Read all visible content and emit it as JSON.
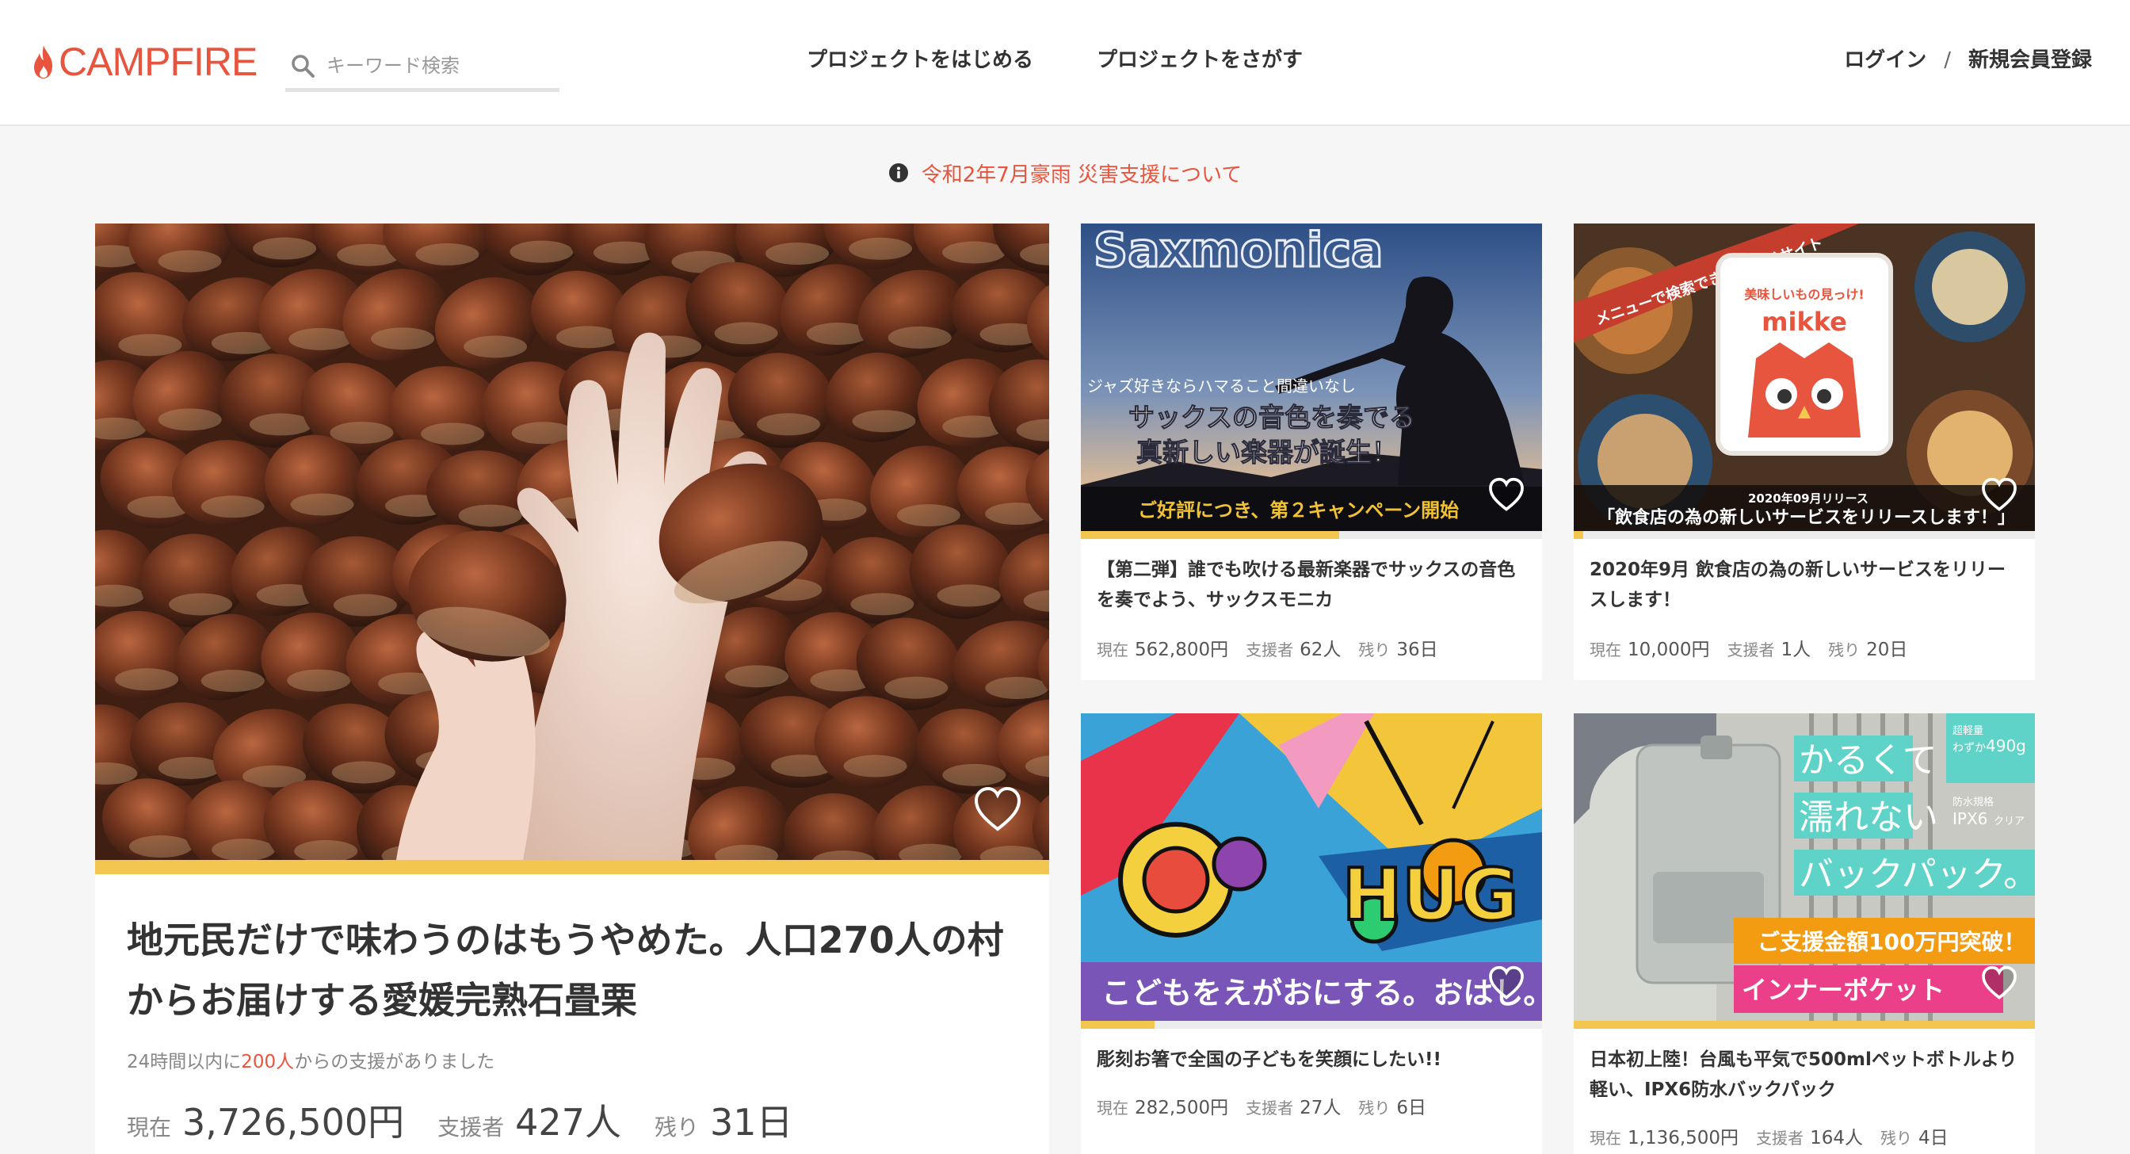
{
  "header": {
    "logo_text": "CAMPFIRE",
    "search_placeholder": "キーワード検索",
    "nav_start": "プロジェクトをはじめる",
    "nav_find": "プロジェクトをさがす",
    "login": "ログイン",
    "separator": "/",
    "register": "新規会員登録"
  },
  "notice": {
    "icon": "info-icon",
    "text": "令和2年7月豪雨 災害支援について"
  },
  "colors": {
    "brand": "#e8553e",
    "progress": "#f3c64f"
  },
  "featured": {
    "title": "地元民だけで味わうのはもうやめた。人口270人の村からお届けする愛媛完熟石畳栗",
    "support_prefix": "24時間以内に",
    "support_count": "200人",
    "support_suffix": "からの支援がありました",
    "raised_label": "現在",
    "raised": "3,726,500円",
    "backers_label": "支援者",
    "backers": "427人",
    "remaining_label": "残り",
    "remaining": "31日",
    "progress": 1.0
  },
  "projects": [
    {
      "banner_title": "Saxmonica",
      "banner_small": "ジャズ好きならハマること間違いなし",
      "banner_main_1": "サックスの音色を奏でる",
      "banner_main_2": "真新しい楽器が誕生！",
      "banner_strip": "ご好評につき、第２キャンペーン開始",
      "title": "【第二弾】誰でも吹ける最新楽器でサックスの音色を奏でよう、サックスモニカ",
      "raised_label": "現在",
      "raised": "562,800円",
      "backers_label": "支援者",
      "backers": "62人",
      "remaining_label": "残り",
      "remaining": "36日",
      "progress": 0.56
    },
    {
      "banner_ribbon": "メニューで検索できるグルメサイト",
      "banner_logo_tag": "美味しいもの見っけ!",
      "banner_logo": "mikke",
      "banner_release": "2020年09月リリース",
      "banner_strip": "「飲食店の為の新しいサービスをリリースします！」",
      "title": "2020年9月 飲食店の為の新しいサービスをリリースします！",
      "raised_label": "現在",
      "raised": "10,000円",
      "backers_label": "支援者",
      "backers": "1人",
      "remaining_label": "残り",
      "remaining": "20日",
      "progress": 0.02
    },
    {
      "banner_strip": "こどもをえがおにする。おはし。",
      "banner_hug": "HUG",
      "title": "彫刻お箸で全国の子どもを笑顔にしたい!!",
      "raised_label": "現在",
      "raised": "282,500円",
      "backers_label": "支援者",
      "backers": "27人",
      "remaining_label": "残り",
      "remaining": "6日",
      "progress": 0.16
    },
    {
      "banner_line1": "かるくて",
      "banner_line2": "濡れない",
      "banner_line3": "バックパック。",
      "banner_tag1_a": "超軽量",
      "banner_tag1_b": "わずか",
      "banner_tag1_c": "490g",
      "banner_tag2_a": "防水規格",
      "banner_tag2_b": "IPX6",
      "banner_tag2_c": "クリア",
      "banner_badge": "ご支援金額100万円突破！",
      "banner_pocket": "インナーポケット",
      "title": "日本初上陸！台風も平気で500mlペットボトルより軽い、IPX6防水バックパック",
      "raised_label": "現在",
      "raised": "1,136,500円",
      "backers_label": "支援者",
      "backers": "164人",
      "remaining_label": "残り",
      "remaining": "4日",
      "progress": 1.0
    }
  ]
}
